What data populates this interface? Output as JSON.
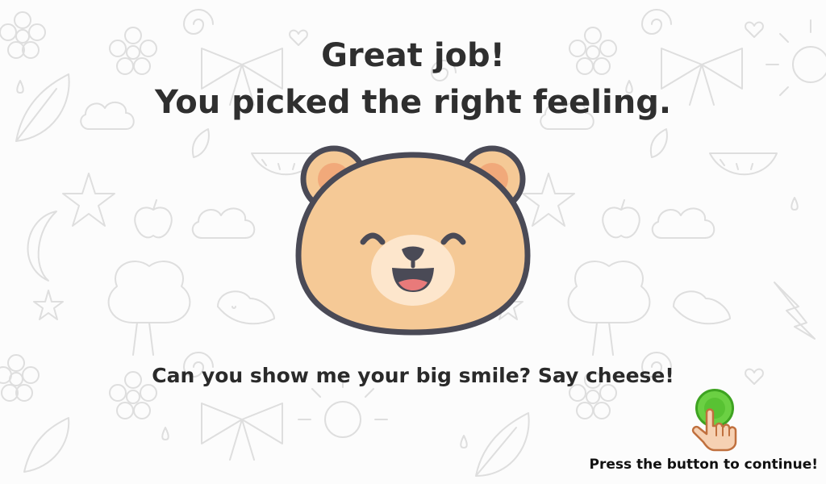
{
  "feedback": {
    "line1": "Great job!",
    "line2": "You picked the right feeling."
  },
  "character": {
    "name": "bear-face",
    "colors": {
      "fur": "#f5c996",
      "ears_inner": "#f1a97a",
      "muzzle": "#fde6cc",
      "outline": "#4a4a56",
      "mouth": "#e97a7a"
    }
  },
  "prompt": "Can you show me your big smile? Say cheese!",
  "continue": {
    "button_color": "#6bd043",
    "hint": "Press the button to continue!"
  }
}
